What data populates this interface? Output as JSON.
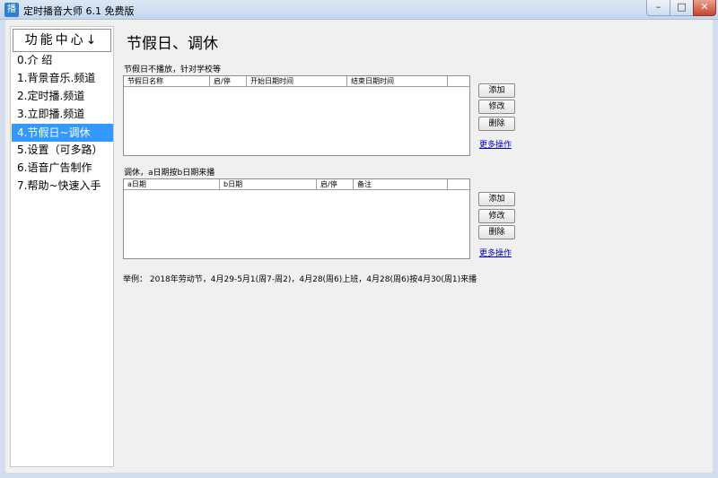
{
  "window": {
    "title": "定时播音大师 6.1 免费版",
    "icon_text": "播",
    "min_glyph": "–",
    "max_glyph": "□",
    "close_glyph": "✕"
  },
  "sidebar": {
    "header": "功能中心↓",
    "items": [
      {
        "label": "0.介  绍"
      },
      {
        "label": "1.背景音乐.频道"
      },
      {
        "label": "2.定时播.频道"
      },
      {
        "label": "3.立即播.频道"
      },
      {
        "label": "4.节假日~调休"
      },
      {
        "label": "5.设置（可多路）"
      },
      {
        "label": "6.语音广告制作"
      },
      {
        "label": "7.帮助~快速入手"
      }
    ],
    "active_index": 4
  },
  "main": {
    "title": "节假日、调休",
    "holiday": {
      "label": "节假日不播放，针对学校等",
      "columns": [
        "节假日名称",
        "启/停",
        "开始日期时间",
        "结束日期时间",
        ""
      ],
      "buttons": {
        "add": "添加",
        "edit": "修改",
        "delete": "删除"
      },
      "more": "更多操作"
    },
    "swap": {
      "label": "调休，a日期按b日期来播",
      "columns": [
        "a日期",
        "b日期",
        "启/停",
        "备注",
        ""
      ],
      "buttons": {
        "add": "添加",
        "edit": "修改",
        "delete": "删除"
      },
      "more": "更多操作"
    },
    "example": "举例：  2018年劳动节，4月29-5月1(周7-周2)，4月28(周6)上班，4月28(周6)按4月30(周1)来播"
  },
  "colors": {
    "selection": "#3399ff",
    "link": "#0000cc",
    "panel_bg": "#f0f0f0"
  }
}
